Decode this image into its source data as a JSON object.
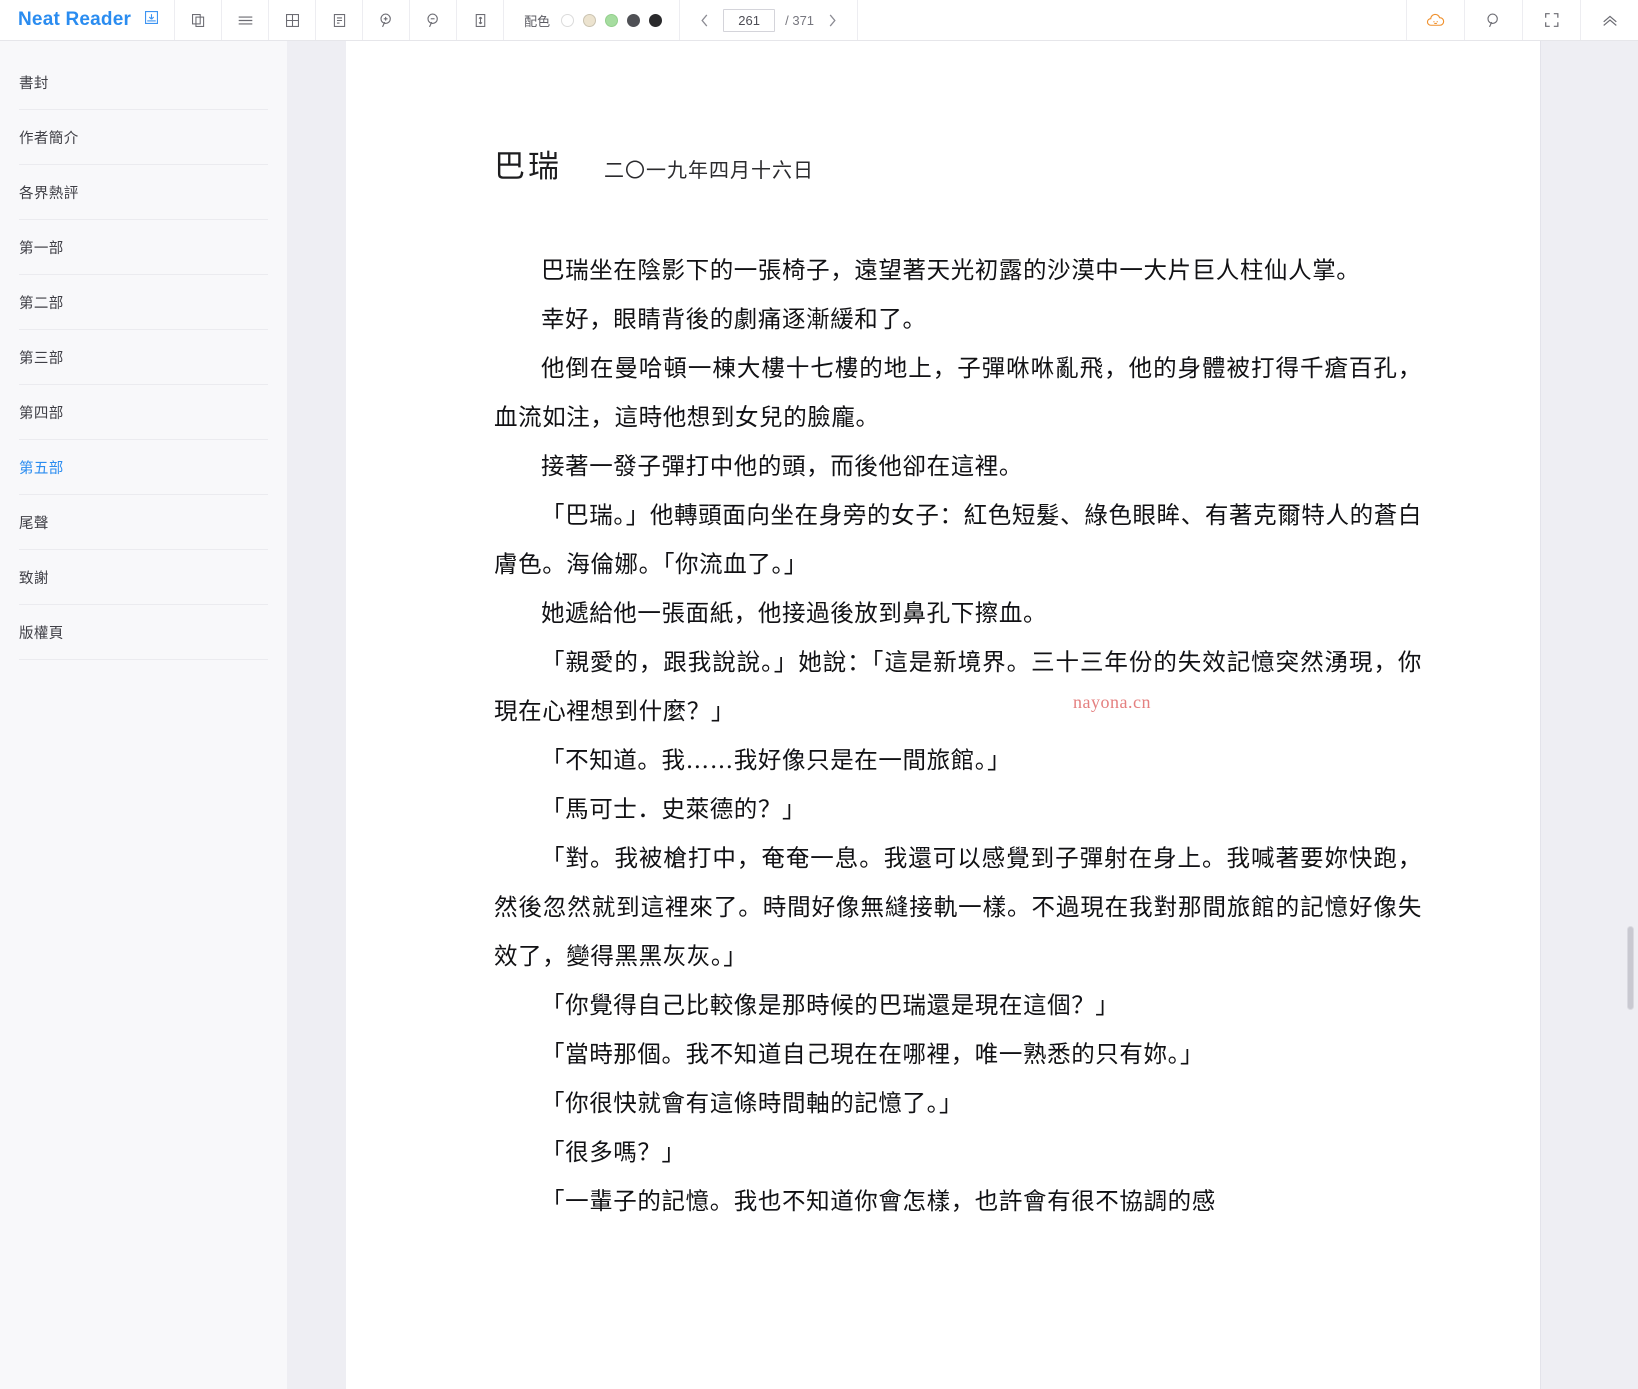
{
  "app": {
    "brand": "Neat Reader"
  },
  "toolbar": {
    "icons": [
      {
        "name": "save-book-icon",
        "label": "save"
      },
      {
        "name": "copy-page-icon",
        "label": "copy"
      },
      {
        "name": "menu-icon",
        "label": "menu"
      },
      {
        "name": "grid-layout-icon",
        "label": "grid"
      },
      {
        "name": "toc-panel-icon",
        "label": "toc"
      },
      {
        "name": "zoom-in-icon",
        "label": "zoom in"
      },
      {
        "name": "zoom-out-icon",
        "label": "zoom out"
      },
      {
        "name": "line-height-icon",
        "label": "line height"
      }
    ],
    "color_label": "配色",
    "swatches": [
      {
        "name": "theme-white",
        "color": "#ffffff"
      },
      {
        "name": "theme-sepia",
        "color": "#ece3cf"
      },
      {
        "name": "theme-green",
        "color": "#a6dda0"
      },
      {
        "name": "theme-gray",
        "color": "#4f5055"
      },
      {
        "name": "theme-black",
        "color": "#2a2a2c"
      }
    ],
    "pager": {
      "prev": "‹",
      "current": "261",
      "total": "/ 371",
      "next": "›"
    },
    "right_icons": [
      {
        "name": "cloud-sync-icon",
        "label": "cloud",
        "color": "#f0912e"
      },
      {
        "name": "search-icon",
        "label": "search"
      },
      {
        "name": "fullscreen-icon",
        "label": "fullscreen"
      },
      {
        "name": "collapse-up-icon",
        "label": "collapse"
      }
    ]
  },
  "sidebar": {
    "items": [
      {
        "label": "書封",
        "active": false
      },
      {
        "label": "作者簡介",
        "active": false
      },
      {
        "label": "各界熱評",
        "active": false
      },
      {
        "label": "第一部",
        "active": false
      },
      {
        "label": "第二部",
        "active": false
      },
      {
        "label": "第三部",
        "active": false
      },
      {
        "label": "第四部",
        "active": false
      },
      {
        "label": "第五部",
        "active": true
      },
      {
        "label": "尾聲",
        "active": false
      },
      {
        "label": "致謝",
        "active": false
      },
      {
        "label": "版權頁",
        "active": false
      }
    ]
  },
  "reader": {
    "chapter_title": "巴瑞",
    "chapter_date": "二〇一九年四月十六日",
    "watermark": "nayona.cn",
    "paragraphs": [
      "巴瑞坐在陰影下的一張椅子，遠望著天光初露的沙漠中一大片巨人柱仙人掌。",
      "幸好，眼睛背後的劇痛逐漸緩和了。",
      "他倒在曼哈頓一棟大樓十七樓的地上，子彈咻咻亂飛，他的身體被打得千瘡百孔，血流如注，這時他想到女兒的臉龐。",
      "接著一發子彈打中他的頭，而後他卻在這裡。",
      "「巴瑞。」他轉頭面向坐在身旁的女子：紅色短髮、綠色眼眸、有著克爾特人的蒼白膚色。海倫娜。「你流血了。」",
      "她遞給他一張面紙，他接過後放到鼻孔下擦血。",
      "「親愛的，跟我說說。」她說：「這是新境界。三十三年份的失效記憶突然湧現，你現在心裡想到什麼？」",
      "「不知道。我……我好像只是在一間旅館。」",
      "「馬可士．史萊德的？」",
      "「對。我被槍打中，奄奄一息。我還可以感覺到子彈射在身上。我喊著要妳快跑，然後忽然就到這裡來了。時間好像無縫接軌一樣。不過現在我對那間旅館的記憶好像失效了，變得黑黑灰灰。」",
      "「你覺得自己比較像是那時候的巴瑞還是現在這個？」",
      "「當時那個。我不知道自己現在在哪裡，唯一熟悉的只有妳。」",
      "「你很快就會有這條時間軸的記憶了。」",
      "「很多嗎？」",
      "「一輩子的記憶。我也不知道你會怎樣，也許會有很不協調的感"
    ]
  }
}
